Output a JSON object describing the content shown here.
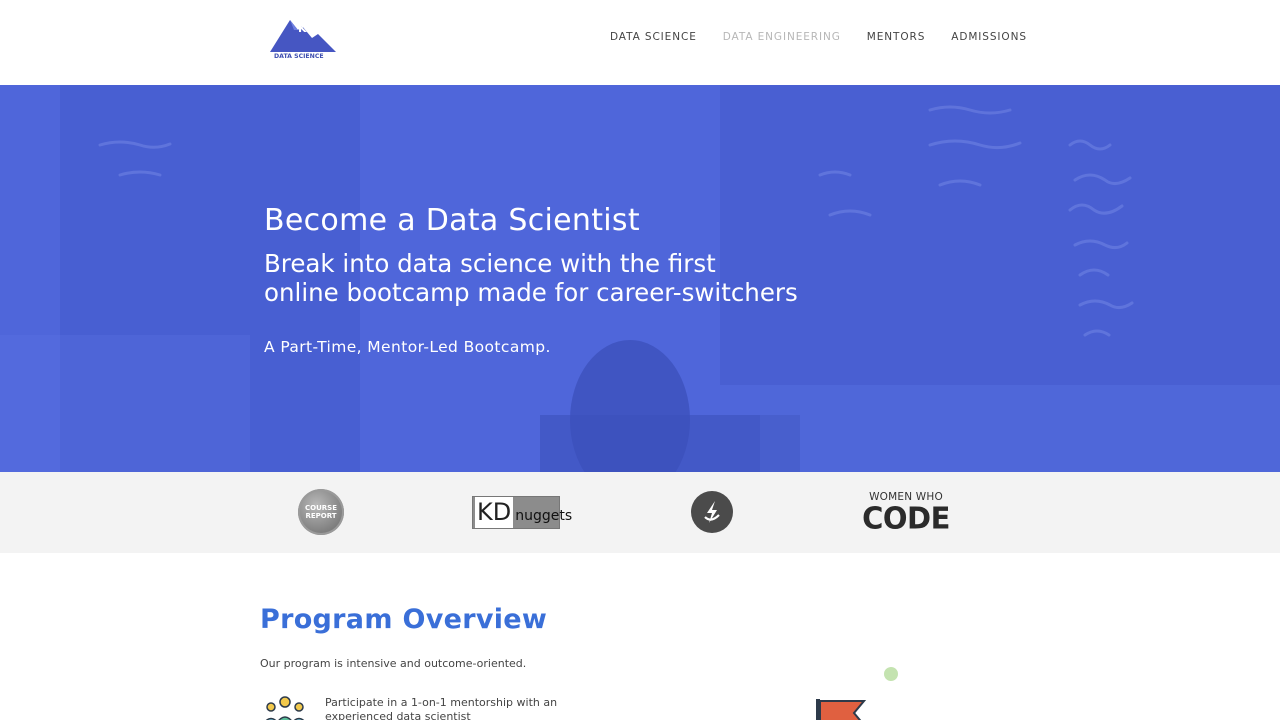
{
  "logo": {
    "mark": "K2",
    "text": "DATA SCIENCE",
    "color": "#3f4fb0"
  },
  "nav": {
    "items": [
      {
        "label": "DATA SCIENCE",
        "muted": false
      },
      {
        "label": "DATA ENGINEERING",
        "muted": true
      },
      {
        "label": "MENTORS",
        "muted": false
      },
      {
        "label": "ADMISSIONS",
        "muted": false
      }
    ]
  },
  "hero": {
    "title": "Become a Data Scientist",
    "subtitle_line1": "Break into data science with the first",
    "subtitle_line2": "online bootcamp made for career-switchers",
    "tagline": "A Part-Time, Mentor-Led Bootcamp.",
    "overlay_color": "#4b62d8"
  },
  "press": {
    "course_report_line1": "COURSE",
    "course_report_line2": "REPORT",
    "kd_k": "KD",
    "kd_n": "nuggets",
    "wwc_line1": "WOMEN WHO",
    "wwc_line2": "CODE"
  },
  "overview": {
    "title": "Program Overview",
    "description": "Our program is intensive and outcome-oriented.",
    "feature1": "Participate in a 1-on-1 mentorship with an experienced data scientist",
    "title_color": "#3a6fd8"
  },
  "icons": {
    "hero_background": "chalkboard-photo",
    "mentors": "people-group-icon",
    "flag": "flag-icon",
    "press_switchup": "switchup-icon"
  }
}
